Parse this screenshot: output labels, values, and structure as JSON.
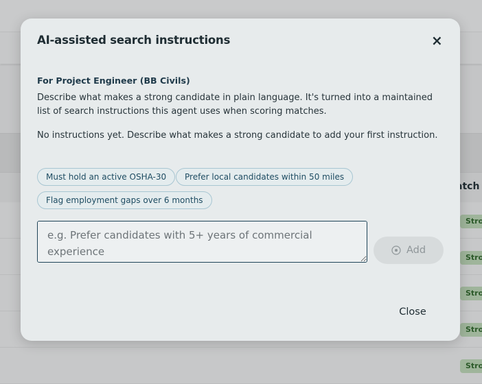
{
  "background": {
    "column_header": "atch",
    "match_badges": [
      "Stron",
      "Stron",
      "Stron",
      "Stron",
      "Stron"
    ]
  },
  "modal": {
    "title": "AI-assisted search instructions",
    "close_icon": "×",
    "subtitle": "For Project Engineer (BB Civils)",
    "description": "Describe what makes a strong candidate in plain language. It's turned into a maintained list of search instructions this agent uses when scoring matches.",
    "empty_state": "No instructions yet. Describe what makes a strong candidate to add your first instruction.",
    "suggestions": [
      "Must hold an active OSHA-30",
      "Prefer local candidates within 50 miles",
      "Flag employment gaps over 6 months"
    ],
    "input": {
      "value": "",
      "placeholder": "e.g. Prefer candidates with 5+ years of commercial experience"
    },
    "add_label": "Add",
    "close_label": "Close"
  },
  "colors": {
    "modal_bg": "#e7ebec",
    "chip_border": "#a8c6d2",
    "chip_text": "#1e4c62",
    "badge_bg": "#9fb59b"
  }
}
